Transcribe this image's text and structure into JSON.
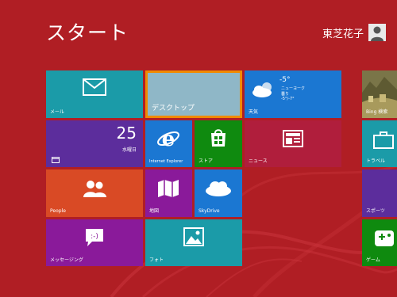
{
  "screen": {
    "title": "スタート",
    "user_name": "東芝花子"
  },
  "tiles": {
    "mail": {
      "label": "メール",
      "icon": "mail-icon",
      "color": "#1b9ba8"
    },
    "desktop": {
      "label": "デスクトップ",
      "color": "#8fb7c7",
      "border": "#f08a00"
    },
    "weather": {
      "label": "天気",
      "temp": "-5°",
      "location": "ニューヨーク",
      "condition": "曇り",
      "range": "-5°/-7°",
      "icon": "cloud-sun-icon",
      "color": "#1b77d2"
    },
    "calendar": {
      "label": "カレンダー",
      "day_number": "25",
      "day_name": "水曜日",
      "icon": "calendar-icon",
      "color": "#5c2d9c"
    },
    "ie": {
      "label": "Internet Explorer",
      "icon": "ie-icon",
      "color": "#1b77d2"
    },
    "store": {
      "label": "ストア",
      "icon": "store-icon",
      "color": "#0f8a0f"
    },
    "news": {
      "label": "ニュース",
      "icon": "news-icon",
      "color": "#b01e3c"
    },
    "people": {
      "label": "People",
      "icon": "people-icon",
      "color": "#d94a25"
    },
    "maps": {
      "label": "地図",
      "icon": "maps-icon",
      "color": "#8a1a9a"
    },
    "skydrive": {
      "label": "SkyDrive",
      "icon": "cloud-icon",
      "color": "#1b77d2"
    },
    "messaging": {
      "label": "メッセージング",
      "icon": "messaging-icon",
      "color": "#8a1a9a"
    },
    "photos": {
      "label": "フォト",
      "icon": "photo-icon",
      "color": "#1b9ba8"
    },
    "bing": {
      "label": "Bing 検索",
      "color": "#6d6a3a"
    },
    "travel": {
      "label": "トラベル",
      "icon": "suitcase-icon",
      "color": "#1b9ba8"
    },
    "sports": {
      "label": "スポーツ",
      "color": "#5c2d9c"
    },
    "games": {
      "label": "ゲーム",
      "icon": "gamepad-icon",
      "color": "#0f8a0f"
    }
  }
}
